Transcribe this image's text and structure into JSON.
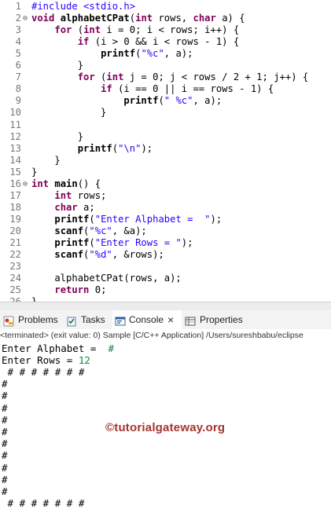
{
  "editor": {
    "lines": [
      {
        "num": "1",
        "fold": "",
        "segs": [
          [
            "inc",
            "#include <stdio.h>"
          ]
        ]
      },
      {
        "num": "2",
        "fold": "⊖",
        "segs": [
          [
            "kw",
            "void"
          ],
          [
            "",
            " "
          ],
          [
            "b",
            "alphabetCPat"
          ],
          [
            "",
            "("
          ],
          [
            "kw",
            "int"
          ],
          [
            "",
            " rows, "
          ],
          [
            "kw",
            "char"
          ],
          [
            "",
            " a) {"
          ]
        ]
      },
      {
        "num": "3",
        "fold": "",
        "segs": [
          [
            "",
            "    "
          ],
          [
            "kw",
            "for"
          ],
          [
            "",
            " ("
          ],
          [
            "kw",
            "int"
          ],
          [
            "",
            " i = 0; i < rows; i++) {"
          ]
        ]
      },
      {
        "num": "4",
        "fold": "",
        "segs": [
          [
            "",
            "        "
          ],
          [
            "kw",
            "if"
          ],
          [
            "",
            " (i > 0 && i < rows - 1) {"
          ]
        ]
      },
      {
        "num": "5",
        "fold": "",
        "segs": [
          [
            "",
            "            "
          ],
          [
            "b",
            "printf"
          ],
          [
            "",
            "("
          ],
          [
            "str",
            "\"%c\""
          ],
          [
            "",
            ", a);"
          ]
        ]
      },
      {
        "num": "6",
        "fold": "",
        "segs": [
          [
            "",
            "        }"
          ]
        ]
      },
      {
        "num": "7",
        "fold": "",
        "segs": [
          [
            "",
            "        "
          ],
          [
            "kw",
            "for"
          ],
          [
            "",
            " ("
          ],
          [
            "kw",
            "int"
          ],
          [
            "",
            " j = 0; j < rows / 2 + 1; j++) {"
          ]
        ]
      },
      {
        "num": "8",
        "fold": "",
        "segs": [
          [
            "",
            "            "
          ],
          [
            "kw",
            "if"
          ],
          [
            "",
            " (i == 0 || i == rows - 1) {"
          ]
        ]
      },
      {
        "num": "9",
        "fold": "",
        "segs": [
          [
            "",
            "                "
          ],
          [
            "b",
            "printf"
          ],
          [
            "",
            "("
          ],
          [
            "str",
            "\" %c\""
          ],
          [
            "",
            ", a);"
          ]
        ]
      },
      {
        "num": "10",
        "fold": "",
        "segs": [
          [
            "",
            "            }"
          ]
        ]
      },
      {
        "num": "11",
        "fold": "",
        "segs": [
          [
            "",
            ""
          ]
        ]
      },
      {
        "num": "12",
        "fold": "",
        "segs": [
          [
            "",
            "        }"
          ]
        ]
      },
      {
        "num": "13",
        "fold": "",
        "segs": [
          [
            "",
            "        "
          ],
          [
            "b",
            "printf"
          ],
          [
            "",
            "("
          ],
          [
            "str",
            "\"\\n\""
          ],
          [
            "",
            ");"
          ]
        ]
      },
      {
        "num": "14",
        "fold": "",
        "segs": [
          [
            "",
            "    }"
          ]
        ]
      },
      {
        "num": "15",
        "fold": "",
        "segs": [
          [
            "",
            "}"
          ]
        ]
      },
      {
        "num": "16",
        "fold": "⊖",
        "segs": [
          [
            "kw",
            "int"
          ],
          [
            "",
            " "
          ],
          [
            "b",
            "main"
          ],
          [
            "",
            "() {"
          ]
        ]
      },
      {
        "num": "17",
        "fold": "",
        "segs": [
          [
            "",
            "    "
          ],
          [
            "kw",
            "int"
          ],
          [
            "",
            " rows;"
          ]
        ]
      },
      {
        "num": "18",
        "fold": "",
        "segs": [
          [
            "",
            "    "
          ],
          [
            "kw",
            "char"
          ],
          [
            "",
            " a;"
          ]
        ]
      },
      {
        "num": "19",
        "fold": "",
        "segs": [
          [
            "",
            "    "
          ],
          [
            "b",
            "printf"
          ],
          [
            "",
            "("
          ],
          [
            "str",
            "\"Enter Alphabet =  \""
          ],
          [
            "",
            ");"
          ]
        ]
      },
      {
        "num": "20",
        "fold": "",
        "segs": [
          [
            "",
            "    "
          ],
          [
            "b",
            "scanf"
          ],
          [
            "",
            "("
          ],
          [
            "str",
            "\"%c\""
          ],
          [
            "",
            ", &a);"
          ]
        ]
      },
      {
        "num": "21",
        "fold": "",
        "segs": [
          [
            "",
            "    "
          ],
          [
            "b",
            "printf"
          ],
          [
            "",
            "("
          ],
          [
            "str",
            "\"Enter Rows = \""
          ],
          [
            "",
            ");"
          ]
        ]
      },
      {
        "num": "22",
        "fold": "",
        "segs": [
          [
            "",
            "    "
          ],
          [
            "b",
            "scanf"
          ],
          [
            "",
            "("
          ],
          [
            "str",
            "\"%d\""
          ],
          [
            "",
            ", &rows);"
          ]
        ]
      },
      {
        "num": "23",
        "fold": "",
        "segs": [
          [
            "",
            ""
          ]
        ]
      },
      {
        "num": "24",
        "fold": "",
        "segs": [
          [
            "",
            "    alphabetCPat(rows, a);"
          ]
        ]
      },
      {
        "num": "25",
        "fold": "",
        "segs": [
          [
            "",
            "    "
          ],
          [
            "kw",
            "return"
          ],
          [
            "",
            " 0;"
          ]
        ]
      },
      {
        "num": "26",
        "fold": "",
        "segs": [
          [
            "",
            "}"
          ]
        ]
      }
    ]
  },
  "tabs": [
    {
      "label": "Problems",
      "icon": "problems-icon",
      "active": false
    },
    {
      "label": "Tasks",
      "icon": "tasks-icon",
      "active": false
    },
    {
      "label": "Console",
      "icon": "console-icon",
      "active": true
    },
    {
      "label": "Properties",
      "icon": "properties-icon",
      "active": false
    }
  ],
  "console_close_icon": "×",
  "status_text": "<terminated> (exit value: 0) Sample [C/C++ Application] /Users/sureshbabu/eclipse",
  "console": {
    "prompt_alphabet": "Enter Alphabet =  ",
    "input_alphabet": "#",
    "prompt_rows": "Enter Rows = ",
    "input_rows": "12",
    "output_lines": [
      " # # # # # # #",
      "#",
      "#",
      "#",
      "#",
      "#",
      "#",
      "#",
      "#",
      "#",
      "#",
      " # # # # # # #"
    ]
  },
  "watermark": "©tutorialgateway.org",
  "colors": {
    "keyword": "#7f0055",
    "string": "#2a00ff",
    "input": "#0b8b3b",
    "watermark": "#a5342d"
  }
}
